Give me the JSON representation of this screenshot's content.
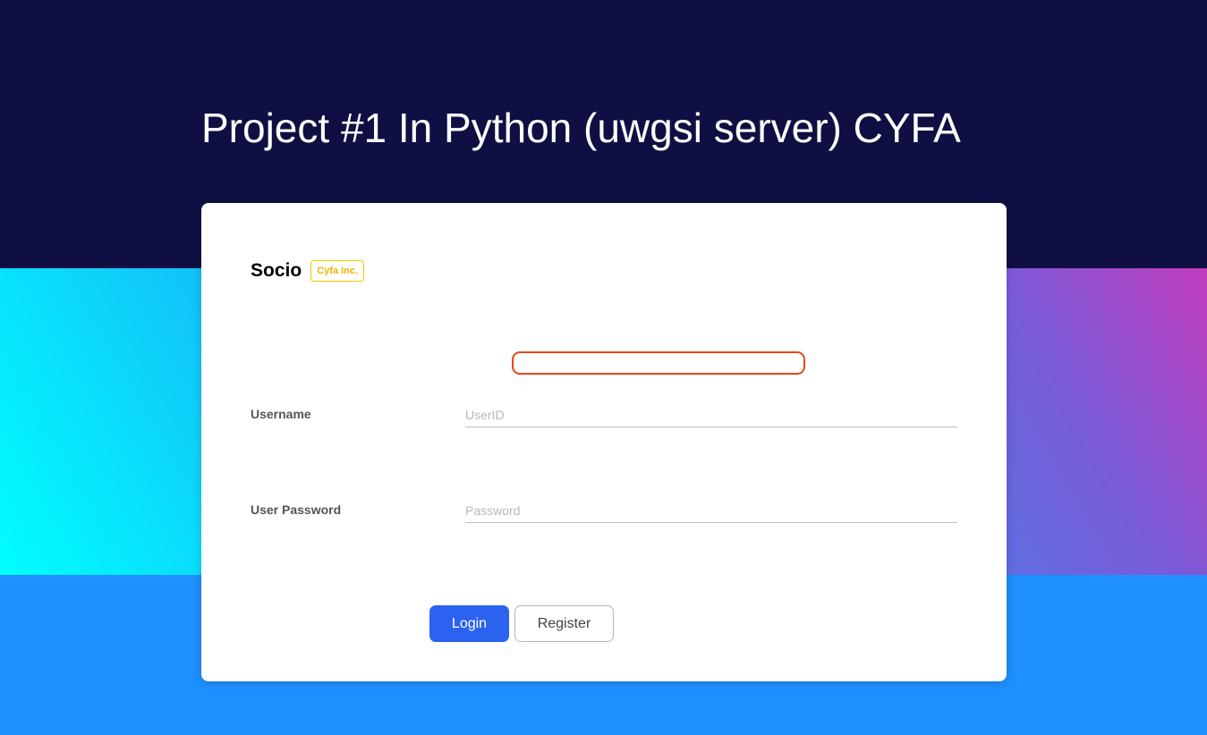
{
  "header": {
    "title": "Project #1 In Python (uwgsi server) CYFA"
  },
  "card": {
    "brand_name": "Socio",
    "brand_badge": "Cyfa Inc.",
    "message": "",
    "username": {
      "label": "Username",
      "placeholder": "UserID",
      "value": ""
    },
    "password": {
      "label": "User Password",
      "placeholder": "Password",
      "value": ""
    },
    "login_label": "Login",
    "register_label": "Register"
  },
  "colors": {
    "header_bg": "#0f0f43",
    "page_bg": "#1e90ff",
    "accent_blue": "#2c62f0",
    "badge_yellow": "#f5c400",
    "error_orange": "#e8461a"
  }
}
